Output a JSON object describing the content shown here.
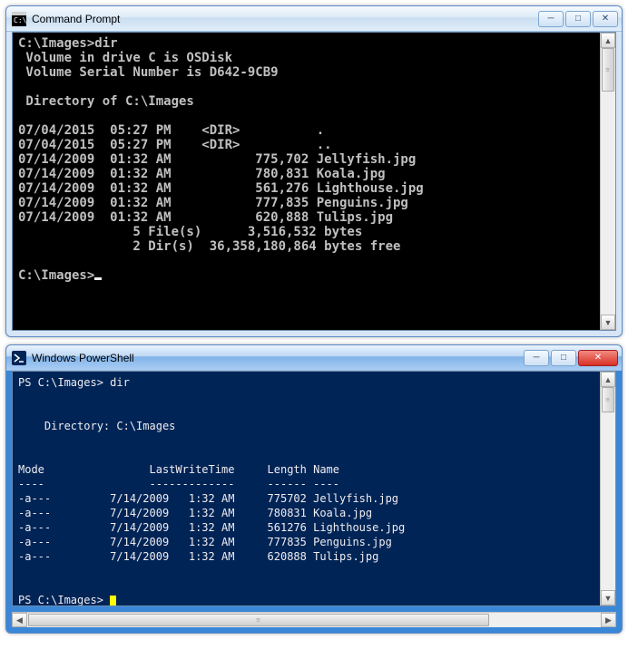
{
  "cmd": {
    "title": "Command Prompt",
    "prompt1": "C:\\Images>dir",
    "vol1": " Volume in drive C is OSDisk",
    "vol2": " Volume Serial Number is D642-9CB9",
    "dirline": " Directory of C:\\Images",
    "rows": [
      "07/04/2015  05:27 PM    <DIR>          .",
      "07/04/2015  05:27 PM    <DIR>          ..",
      "07/14/2009  01:32 AM           775,702 Jellyfish.jpg",
      "07/14/2009  01:32 AM           780,831 Koala.jpg",
      "07/14/2009  01:32 AM           561,276 Lighthouse.jpg",
      "07/14/2009  01:32 AM           777,835 Penguins.jpg",
      "07/14/2009  01:32 AM           620,888 Tulips.jpg"
    ],
    "sum1": "               5 File(s)      3,516,532 bytes",
    "sum2": "               2 Dir(s)  36,358,180,864 bytes free",
    "prompt2": "C:\\Images>"
  },
  "ps": {
    "title": "Windows PowerShell",
    "prompt1": "PS C:\\Images> dir",
    "dirline": "    Directory: C:\\Images",
    "header": "Mode                LastWriteTime     Length Name",
    "hline": "----                -------------     ------ ----",
    "rows": [
      "-a---         7/14/2009   1:32 AM     775702 Jellyfish.jpg",
      "-a---         7/14/2009   1:32 AM     780831 Koala.jpg",
      "-a---         7/14/2009   1:32 AM     561276 Lighthouse.jpg",
      "-a---         7/14/2009   1:32 AM     777835 Penguins.jpg",
      "-a---         7/14/2009   1:32 AM     620888 Tulips.jpg"
    ],
    "prompt2": "PS C:\\Images> "
  }
}
